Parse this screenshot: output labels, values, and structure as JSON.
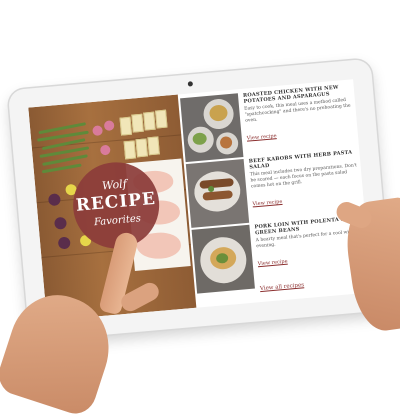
{
  "hero": {
    "badge_top": "Wolf",
    "badge_mid": "RECIPE",
    "badge_bot": "Favorites"
  },
  "recipes": [
    {
      "title": "Roasted chicken with new potatoes and asparagus",
      "description": "Easy to cook, this meal uses a method called \"spatchcocking\" and there's no prehoating the oven.",
      "link": "View recipe"
    },
    {
      "title": "Beef kabobs with herb pasta salad",
      "description": "This meal includes two dry preparations. Don't be scared — each focus on the pasta salad comes hot on the grill.",
      "link": "View recipe"
    },
    {
      "title": "Pork loin with polenta and green beans",
      "description": "A hearty meal that's perfect for a cool winter evening.",
      "link": "View recipe"
    }
  ],
  "view_all": "View all recipes",
  "colors": {
    "badge": "#8c3c3a",
    "link": "#8b2f2f",
    "wood": "#a7703f"
  }
}
